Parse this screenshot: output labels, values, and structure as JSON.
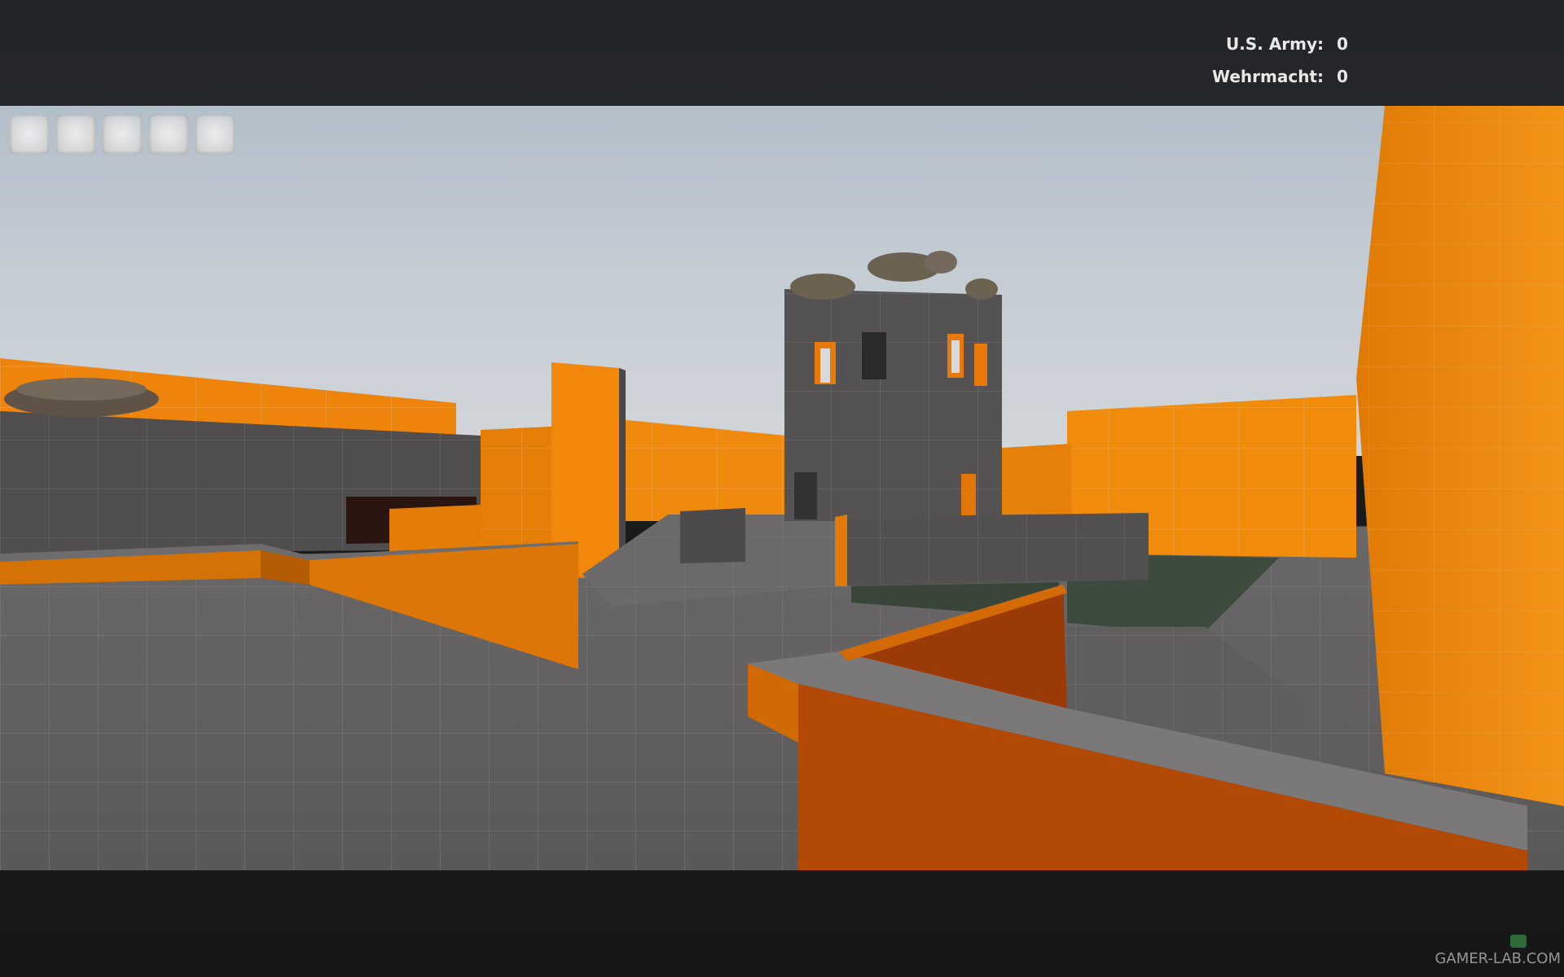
{
  "scoreboard": {
    "teams": [
      {
        "label": "U.S. Army:",
        "score": "0"
      },
      {
        "label": "Wehrmacht:",
        "score": "0"
      }
    ]
  },
  "hud": {
    "item_slots": [
      {
        "icon": "empty-slot-icon"
      },
      {
        "icon": "empty-slot-icon"
      },
      {
        "icon": "empty-slot-icon"
      },
      {
        "icon": "empty-slot-icon"
      },
      {
        "icon": "empty-slot-icon"
      }
    ]
  },
  "watermark": {
    "text": "GAMER-LAB.COM"
  },
  "colors": {
    "wall_orange": "#f0860c",
    "floor_gray": "#5d5b5b",
    "concrete_gray": "#555354",
    "sky": "#bcc7d1",
    "water": "#3c4a40"
  }
}
